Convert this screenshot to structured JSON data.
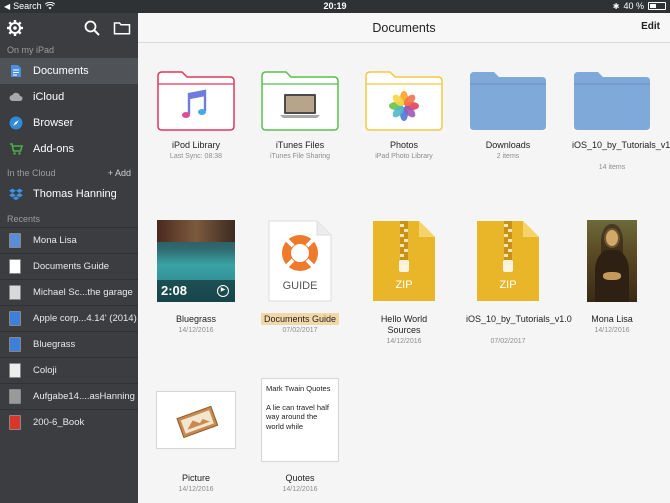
{
  "statusbar": {
    "carrier": "Search",
    "time": "20:19",
    "battery": "40 %"
  },
  "sidebar": {
    "section_local": "On my iPad",
    "nav": [
      {
        "label": "Documents",
        "icon": "document-icon",
        "color": "#4a90e2"
      },
      {
        "label": "iCloud",
        "icon": "cloud-icon",
        "color": "#a8a8a8"
      },
      {
        "label": "Browser",
        "icon": "compass-icon",
        "color": "#2f8bd6"
      },
      {
        "label": "Add-ons",
        "icon": "cart-icon",
        "color": "#4cb04b"
      }
    ],
    "section_cloud": "In the Cloud",
    "add_label": "+ Add",
    "cloud_account": "Thomas Hanning",
    "section_recents": "Recents",
    "recents": [
      {
        "label": "Mona Lisa",
        "icon": "image-file-icon",
        "color": "#5b8ed6"
      },
      {
        "label": "Documents Guide",
        "icon": "guide-file-icon",
        "color": "#ffffff"
      },
      {
        "label": "Michael Sc...the garage",
        "icon": "pdf-file-icon",
        "color": "#d9d9d9"
      },
      {
        "label": "Apple corp...4.14' (2014)",
        "icon": "doc-file-icon",
        "color": "#3d7fd9"
      },
      {
        "label": "Bluegrass",
        "icon": "music-file-icon",
        "color": "#3d7fd9"
      },
      {
        "label": "Coloji",
        "icon": "text-file-icon",
        "color": "#ededed"
      },
      {
        "label": "Aufgabe14....asHanning",
        "icon": "numbered-file-icon",
        "color": "#9a9a9a"
      },
      {
        "label": "200-6_Book",
        "icon": "pdf-red-file-icon",
        "color": "#d9352b"
      }
    ]
  },
  "header": {
    "title": "Documents",
    "edit_label": "Edit"
  },
  "files": [
    {
      "name": "iPod Library",
      "sub": "Last Sync: 08:38",
      "icon": "music-folder-icon",
      "color": "#e4375a"
    },
    {
      "name": "iTunes Files",
      "sub": "iTunes File Sharing",
      "icon": "laptop-folder-icon",
      "color": "#59c04e"
    },
    {
      "name": "Photos",
      "sub": "iPad Photo Library",
      "icon": "photos-folder-icon",
      "color": "#f5c843"
    },
    {
      "name": "Downloads",
      "sub": "2 items",
      "icon": "folder-icon",
      "color": "#7fa9d9"
    },
    {
      "name": "iOS_10_by_Tutorials_v1.0",
      "sub": "14 items",
      "icon": "folder-icon",
      "color": "#7fa9d9"
    },
    {
      "name": "Bluegrass",
      "sub": "14/12/2016",
      "icon": "video-thumbnail-icon",
      "duration": "2:08"
    },
    {
      "name": "Documents Guide",
      "sub": "07/02/2017",
      "icon": "lifebuoy-guide-icon",
      "badge": "GUIDE"
    },
    {
      "name": "Hello World Sources",
      "sub": "14/12/2016",
      "icon": "zip-file-icon",
      "badge": "ZIP"
    },
    {
      "name": "iOS_10_by_Tutorials_v1.0",
      "sub": "07/02/2017",
      "icon": "zip-file-icon",
      "badge": "ZIP"
    },
    {
      "name": "Mona Lisa",
      "sub": "14/12/2016",
      "icon": "painting-thumbnail-icon"
    },
    {
      "name": "Picture",
      "sub": "14/12/2016",
      "icon": "picture-thumbnail-icon"
    },
    {
      "name": "Quotes",
      "sub": "14/12/2016",
      "icon": "text-note-thumbnail-icon",
      "preview_title": "Mark Twain Quotes",
      "preview_body": "A lie can travel half way around the world while"
    }
  ]
}
